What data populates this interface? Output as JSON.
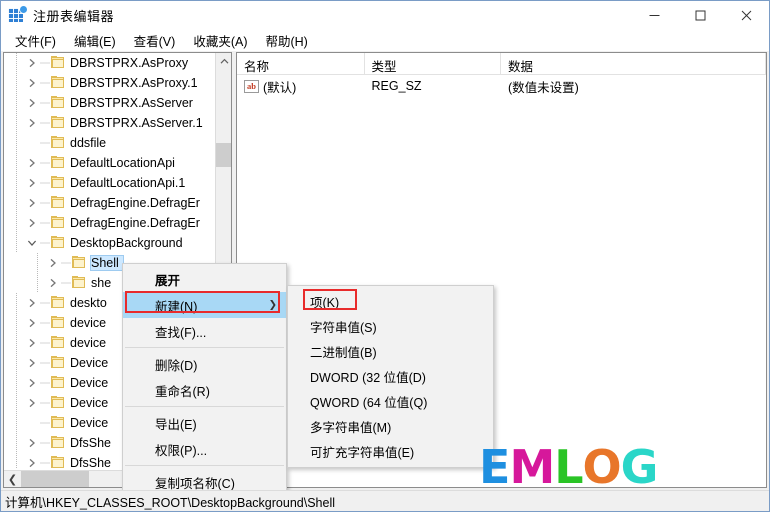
{
  "window": {
    "title": "注册表编辑器",
    "icon": "registry-editor-icon",
    "minimize": "—",
    "maximize": "□",
    "close": "✕"
  },
  "menubar": {
    "items": [
      {
        "label": "文件(F)",
        "name": "menu-file"
      },
      {
        "label": "编辑(E)",
        "name": "menu-edit"
      },
      {
        "label": "查看(V)",
        "name": "menu-view"
      },
      {
        "label": "收藏夹(A)",
        "name": "menu-favorites"
      },
      {
        "label": "帮助(H)",
        "name": "menu-help"
      }
    ]
  },
  "tree": {
    "items": [
      {
        "label": "DBRSTPRX.AsProxy",
        "depth": 1,
        "expander": "collapsed",
        "selected": false
      },
      {
        "label": "DBRSTPRX.AsProxy.1",
        "depth": 1,
        "expander": "collapsed",
        "selected": false
      },
      {
        "label": "DBRSTPRX.AsServer",
        "depth": 1,
        "expander": "collapsed",
        "selected": false
      },
      {
        "label": "DBRSTPRX.AsServer.1",
        "depth": 1,
        "expander": "collapsed",
        "selected": false
      },
      {
        "label": "ddsfile",
        "depth": 1,
        "expander": "none",
        "selected": false
      },
      {
        "label": "DefaultLocationApi",
        "depth": 1,
        "expander": "collapsed",
        "selected": false
      },
      {
        "label": "DefaultLocationApi.1",
        "depth": 1,
        "expander": "collapsed",
        "selected": false
      },
      {
        "label": "DefragEngine.DefragEr",
        "depth": 1,
        "expander": "collapsed",
        "selected": false
      },
      {
        "label": "DefragEngine.DefragEr",
        "depth": 1,
        "expander": "collapsed",
        "selected": false
      },
      {
        "label": "DesktopBackground",
        "depth": 1,
        "expander": "expanded",
        "selected": false
      },
      {
        "label": "Shell",
        "depth": 2,
        "expander": "collapsed",
        "selected": true
      },
      {
        "label": "she",
        "depth": 2,
        "expander": "collapsed",
        "selected": false
      },
      {
        "label": "deskto",
        "depth": 1,
        "expander": "collapsed",
        "selected": false
      },
      {
        "label": "device",
        "depth": 1,
        "expander": "collapsed",
        "selected": false
      },
      {
        "label": "device",
        "depth": 1,
        "expander": "collapsed",
        "selected": false
      },
      {
        "label": "Device",
        "depth": 1,
        "expander": "collapsed",
        "selected": false
      },
      {
        "label": "Device",
        "depth": 1,
        "expander": "collapsed",
        "selected": false
      },
      {
        "label": "Device",
        "depth": 1,
        "expander": "collapsed",
        "selected": false
      },
      {
        "label": "Device",
        "depth": 1,
        "expander": "none",
        "selected": false
      },
      {
        "label": "DfsShe",
        "depth": 1,
        "expander": "collapsed",
        "selected": false
      },
      {
        "label": "DfsShe",
        "depth": 1,
        "expander": "collapsed",
        "selected": false
      }
    ],
    "scroll_left_arrow": "❮",
    "scroll_right_arrow": "❯"
  },
  "values": {
    "columns": [
      "名称",
      "类型",
      "数据"
    ],
    "rows": [
      {
        "name": "(默认)",
        "type": "REG_SZ",
        "data": "(数值未设置)",
        "icon": "ab-string-icon",
        "icon_text": "ab"
      }
    ]
  },
  "context_menu": {
    "items": [
      {
        "label": "展开",
        "name": "ctx-expand",
        "bold": true,
        "highlighted": false,
        "submenu": false,
        "separator_after": false
      },
      {
        "label": "新建(N)",
        "name": "ctx-new",
        "bold": false,
        "highlighted": true,
        "submenu": true,
        "separator_after": false
      },
      {
        "label": "查找(F)...",
        "name": "ctx-find",
        "bold": false,
        "highlighted": false,
        "submenu": false,
        "separator_after": true
      },
      {
        "label": "删除(D)",
        "name": "ctx-delete",
        "bold": false,
        "highlighted": false,
        "submenu": false,
        "separator_after": false
      },
      {
        "label": "重命名(R)",
        "name": "ctx-rename",
        "bold": false,
        "highlighted": false,
        "submenu": false,
        "separator_after": true
      },
      {
        "label": "导出(E)",
        "name": "ctx-export",
        "bold": false,
        "highlighted": false,
        "submenu": false,
        "separator_after": false
      },
      {
        "label": "权限(P)...",
        "name": "ctx-permissions",
        "bold": false,
        "highlighted": false,
        "submenu": false,
        "separator_after": true
      },
      {
        "label": "复制项名称(C)",
        "name": "ctx-copy-key-name",
        "bold": false,
        "highlighted": false,
        "submenu": false,
        "separator_after": false
      }
    ],
    "submenu_arrow": "❯"
  },
  "submenu": {
    "items": [
      {
        "label": "项(K)",
        "name": "new-key",
        "boxed": true
      },
      {
        "label": "字符串值(S)",
        "name": "new-string",
        "boxed": false
      },
      {
        "label": "二进制值(B)",
        "name": "new-binary",
        "boxed": false
      },
      {
        "label": "DWORD (32 位值(D)",
        "name": "new-dword",
        "boxed": false
      },
      {
        "label": "QWORD (64 位值(Q)",
        "name": "new-qword",
        "boxed": false
      },
      {
        "label": "多字符串值(M)",
        "name": "new-multi-string",
        "boxed": false
      },
      {
        "label": "可扩充字符串值(E)",
        "name": "new-expand-string",
        "boxed": false
      }
    ]
  },
  "statusbar": {
    "path": "计算机\\HKEY_CLASSES_ROOT\\DesktopBackground\\Shell"
  },
  "watermark": {
    "letters": [
      {
        "char": "E",
        "color": "#1e8fe0"
      },
      {
        "char": "M",
        "color": "#d6189b"
      },
      {
        "char": "L",
        "color": "#2ac426"
      },
      {
        "char": "O",
        "color": "#e8762a"
      },
      {
        "char": "G",
        "color": "#2ad6c8"
      }
    ]
  },
  "annotations": {
    "highlight_color": "#e82b2b",
    "selection_color": "#a8d8f5"
  }
}
